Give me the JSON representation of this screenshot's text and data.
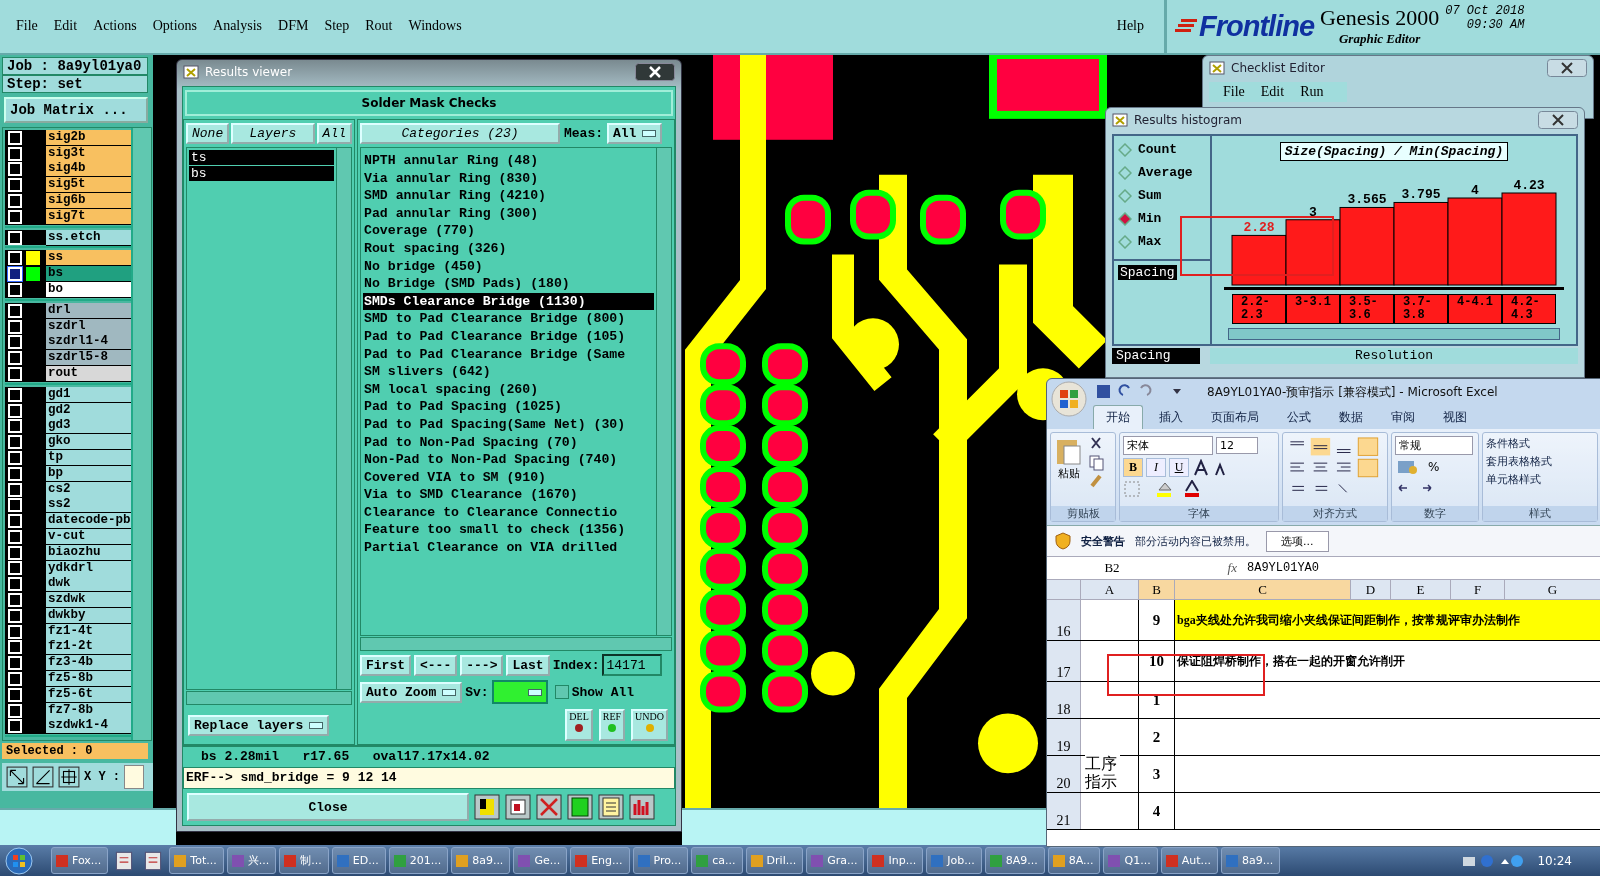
{
  "menu_bar": {
    "items": [
      "File",
      "Edit",
      "Actions",
      "Options",
      "Analysis",
      "DFM",
      "Step",
      "Rout",
      "Windows"
    ],
    "help": "Help"
  },
  "brand": {
    "logo": "Frontline",
    "product": "Genesis 2000",
    "subtitle": "Graphic Editor",
    "date": "07 Oct 2018",
    "time": "09:30 AM"
  },
  "job_panel": {
    "job": "Job : 8a9yl01ya0",
    "step": "Step: set",
    "matrix_button": "Job Matrix ...",
    "layer_groups": [
      {
        "layers": [
          {
            "name": "sig2b",
            "color": "#f8c060",
            "selected": false
          },
          {
            "name": "sig3t",
            "color": "#f8c060",
            "selected": false
          },
          {
            "name": "sig4b",
            "color": "#f8c060",
            "selected": false
          },
          {
            "name": "sig5t",
            "color": "#f8c060",
            "selected": false
          },
          {
            "name": "sig6b",
            "color": "#f8c060",
            "selected": false
          },
          {
            "name": "sig7t",
            "color": "#f8c060",
            "selected": false
          }
        ]
      },
      {
        "layers": [
          {
            "name": "ss.etch",
            "color": "#a0dcdc",
            "selected": false
          }
        ]
      },
      {
        "layers": [
          {
            "name": "ss",
            "color": "#f8c060",
            "swatch": {
              "color": "#ffff00"
            },
            "selected": false
          },
          {
            "name": "bs",
            "color": "#20a080",
            "swatch": {
              "color": "#00ff00"
            },
            "selected": true
          },
          {
            "name": "bo",
            "color": "#ffffff",
            "selected": false
          }
        ]
      },
      {
        "layers": [
          {
            "name": "drl",
            "color": "#a0b8c0",
            "selected": false
          },
          {
            "name": "szdrl",
            "color": "#a0b8c0",
            "selected": false
          },
          {
            "name": "szdrl1-4",
            "color": "#a0b8c0",
            "selected": false
          },
          {
            "name": "szdrl5-8",
            "color": "#a0b8c0",
            "selected": false
          },
          {
            "name": "rout",
            "color": "#d8d8d8",
            "selected": false
          }
        ]
      },
      {
        "layers": [
          {
            "name": "gd1",
            "color": "#a0dcdc",
            "selected": false
          },
          {
            "name": "gd2",
            "color": "#a0dcdc",
            "selected": false
          },
          {
            "name": "gd3",
            "color": "#a0dcdc",
            "selected": false
          },
          {
            "name": "gko",
            "color": "#a0dcdc",
            "selected": false
          },
          {
            "name": "tp",
            "color": "#a0dcdc",
            "selected": false
          },
          {
            "name": "bp",
            "color": "#a0dcdc",
            "selected": false
          },
          {
            "name": "cs2",
            "color": "#a0dcdc",
            "selected": false
          },
          {
            "name": "ss2",
            "color": "#a0dcdc",
            "selected": false
          },
          {
            "name": "datecode-pb",
            "color": "#a0dcdc",
            "selected": false
          },
          {
            "name": "v-cut",
            "color": "#a0dcdc",
            "selected": false
          },
          {
            "name": "biaozhu",
            "color": "#a0dcdc",
            "selected": false
          },
          {
            "name": "ydkdrl",
            "color": "#a0dcdc",
            "selected": false
          },
          {
            "name": "dwk",
            "color": "#a0dcdc",
            "selected": false
          },
          {
            "name": "szdwk",
            "color": "#a0dcdc",
            "selected": false
          },
          {
            "name": "dwkby",
            "color": "#a0dcdc",
            "selected": false
          },
          {
            "name": "fz1-4t",
            "color": "#a0dcdc",
            "selected": false
          },
          {
            "name": "fz1-2t",
            "color": "#a0dcdc",
            "selected": false
          },
          {
            "name": "fz3-4b",
            "color": "#a0dcdc",
            "selected": false
          },
          {
            "name": "fz5-8b",
            "color": "#a0dcdc",
            "selected": false
          },
          {
            "name": "fz5-6t",
            "color": "#a0dcdc",
            "selected": false
          },
          {
            "name": "fz7-8b",
            "color": "#a0dcdc",
            "selected": false
          },
          {
            "name": "szdwk1-4",
            "color": "#a0dcdc",
            "selected": false
          }
        ]
      }
    ],
    "selected_count": "Selected : 0",
    "xy_label": "X Y :"
  },
  "results_viewer": {
    "title": "Results viewer",
    "header": "Solder Mask Checks",
    "layer_buttons": [
      "None",
      "Layers",
      "All"
    ],
    "layers": [
      {
        "name": "ts",
        "selected": true
      },
      {
        "name": "bs",
        "selected": true
      }
    ],
    "categories_button": "Categories (23)",
    "meas_label": "Meas:",
    "meas_value": "All",
    "categories": [
      {
        "label": "NPTH annular Ring (48)",
        "selected": false
      },
      {
        "label": "Via annular Ring (830)",
        "selected": false
      },
      {
        "label": "SMD annular Ring (4210)",
        "selected": false
      },
      {
        "label": "Pad annular Ring (300)",
        "selected": false
      },
      {
        "label": "Coverage (770)",
        "selected": false
      },
      {
        "label": "Rout spacing (326)",
        "selected": false
      },
      {
        "label": "No bridge (450)",
        "selected": false
      },
      {
        "label": "No Bridge (SMD Pads) (180)",
        "selected": false
      },
      {
        "label": "SMDs Clearance Bridge (1130)",
        "selected": true
      },
      {
        "label": "SMD to Pad Clearance Bridge (800)",
        "selected": false
      },
      {
        "label": "Pad to Pad Clearance Bridge (105)",
        "selected": false
      },
      {
        "label": "Pad to Pad Clearance Bridge (Same",
        "selected": false
      },
      {
        "label": "SM slivers (642)",
        "selected": false
      },
      {
        "label": "SM local spacing (260)",
        "selected": false
      },
      {
        "label": "Pad to Pad Spacing (1025)",
        "selected": false
      },
      {
        "label": "Pad to Pad Spacing(Same Net) (30)",
        "selected": false
      },
      {
        "label": "Pad to Non-Pad Spacing (70)",
        "selected": false
      },
      {
        "label": "Non-Pad to Non-Pad Spacing (740)",
        "selected": false
      },
      {
        "label": "Covered VIA to SM (910)",
        "selected": false
      },
      {
        "label": "Via to SMD Clearance (1670)",
        "selected": false
      },
      {
        "label": "Clearance to Clearance Connectio",
        "selected": false
      },
      {
        "label": "Feature too small to check (1356)",
        "selected": false
      },
      {
        "label": "Partial Clearance on VIA drilled",
        "selected": false
      }
    ],
    "nav_buttons": [
      "First",
      "<---",
      "--->",
      "Last"
    ],
    "index_label": "Index:",
    "index_value": "14171",
    "zoom_mode": "Auto Zoom",
    "sv_label": "Sv:",
    "show_all": {
      "label": "Show All",
      "checked": false
    },
    "replace_button": "Replace layers",
    "tool_buttons": [
      "DEL",
      "REF",
      "UNDO"
    ],
    "status": "bs 2.28mil   r17.65   oval17.17x14.02",
    "erf": "ERF--> smd_bridge = 9 12 14",
    "close_button": "Close"
  },
  "checklist_editor": {
    "title": "Checklist Editor",
    "menu": [
      "File",
      "Edit",
      "Run"
    ]
  },
  "histogram": {
    "title": "Results histogram",
    "modes": [
      {
        "label": "Count",
        "selected": false
      },
      {
        "label": "Average",
        "selected": false
      },
      {
        "label": "Sum",
        "selected": false
      },
      {
        "label": "Min",
        "selected": true
      },
      {
        "label": "Max",
        "selected": false
      }
    ],
    "attributes": [
      {
        "label": "Spacing",
        "selected": true
      }
    ],
    "chart_data": {
      "type": "bar",
      "title": "Size(Spacing) / Min(Spacing)",
      "categories": [
        "2.2-2.3",
        "3-3.1",
        "3.5-3.6",
        "3.7-3.8",
        "4-4.1",
        "4.2-4.3"
      ],
      "values": [
        2.28,
        3,
        3.565,
        3.795,
        4,
        4.23
      ],
      "data_labels": true
    },
    "footer": [
      "Spacing",
      "Resolution"
    ]
  },
  "excel": {
    "title": "8A9YL01YA0-预审指示  [兼容模式] - Microsoft Excel",
    "tabs": [
      {
        "label": "开始",
        "selected": true
      },
      {
        "label": "插入",
        "selected": false
      },
      {
        "label": "页面布局",
        "selected": false
      },
      {
        "label": "公式",
        "selected": false
      },
      {
        "label": "数据",
        "selected": false
      },
      {
        "label": "审阅",
        "selected": false
      },
      {
        "label": "视图",
        "selected": false
      }
    ],
    "paste": "粘贴",
    "font_name": "宋体",
    "font_size": "12",
    "format_buttons": [
      "B",
      "I",
      "U"
    ],
    "number_format": "常规",
    "percent": "%",
    "styles": [
      "条件格式",
      "套用表格格式",
      "单元格样式"
    ],
    "groups": [
      "剪贴板",
      "字体",
      "对齐方式",
      "数字",
      "样式"
    ],
    "security": {
      "title": "安全警告",
      "message": "部分活动内容已被禁用。",
      "button": "选项..."
    },
    "name_box": "B2",
    "fx": "fx",
    "formula": "8A9YL01YA0",
    "columns": [
      "A",
      "B",
      "C",
      "D",
      "E",
      "F",
      "G"
    ],
    "rows": [
      {
        "number": "16",
        "b": "9",
        "c": "bga夹线处允许我司缩小夹线保证间距制作，按常规评审办法制作",
        "highlight": true
      },
      {
        "number": "17",
        "b": "10",
        "c": "保证阻焊桥制作，搭在一起的开窗允许削开",
        "highlight": false
      },
      {
        "number": "18",
        "b": "1",
        "highlight": false
      },
      {
        "number": "19",
        "b": "2",
        "highlight": false
      },
      {
        "number": "20",
        "b": "3",
        "highlight": false
      },
      {
        "number": "21",
        "b": "4",
        "highlight": false
      }
    ],
    "merged_label": "工序指示"
  },
  "taskbar": {
    "items": [
      {
        "kind": "app",
        "label": "Fox..."
      },
      {
        "kind": "icon"
      },
      {
        "kind": "icon"
      },
      {
        "kind": "app",
        "label": "Tot..."
      },
      {
        "kind": "app",
        "label": "兴..."
      },
      {
        "kind": "app",
        "label": "制..."
      },
      {
        "kind": "app",
        "label": "ED..."
      },
      {
        "kind": "app",
        "label": "201..."
      },
      {
        "kind": "app",
        "label": "8a9..."
      },
      {
        "kind": "app",
        "label": "Ge..."
      },
      {
        "kind": "app",
        "label": "Eng..."
      },
      {
        "kind": "app",
        "label": "Pro..."
      },
      {
        "kind": "app",
        "label": "ca..."
      },
      {
        "kind": "app",
        "label": "Dril..."
      },
      {
        "kind": "app",
        "label": "Gra..."
      },
      {
        "kind": "app",
        "label": "Inp..."
      },
      {
        "kind": "app",
        "label": "Job..."
      },
      {
        "kind": "app",
        "label": "8A9..."
      },
      {
        "kind": "app",
        "label": "8A..."
      },
      {
        "kind": "app",
        "label": "Q1..."
      },
      {
        "kind": "app",
        "label": "Aut..."
      },
      {
        "kind": "app",
        "label": "8a9..."
      }
    ],
    "clock": "10:24"
  }
}
